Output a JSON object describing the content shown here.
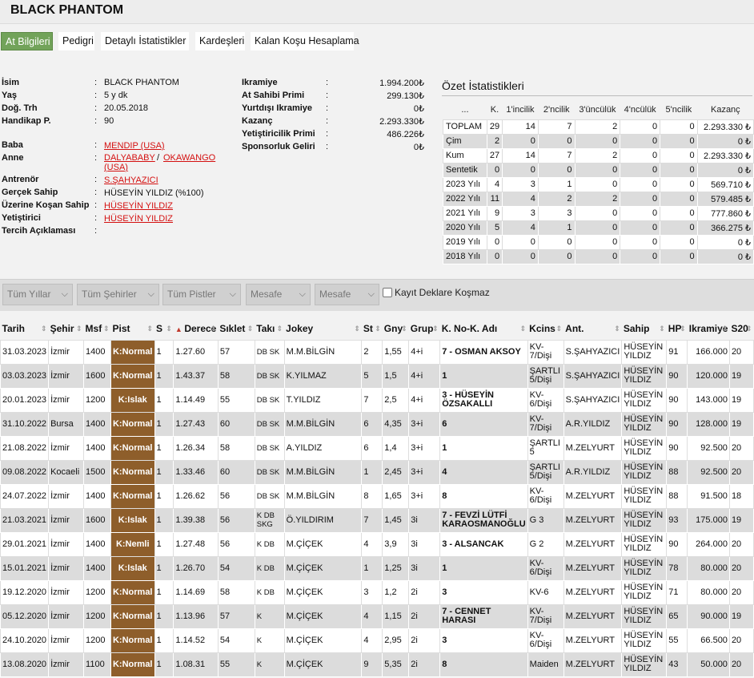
{
  "horse_name": "BLACK PHANTOM",
  "tabs": [
    {
      "label": "At Bilgileri"
    },
    {
      "label": "Pedigri"
    },
    {
      "label": "Detaylı İstatistikler"
    },
    {
      "label": "Kardeşleri"
    },
    {
      "label": "Kalan Koşu Hesaplama"
    }
  ],
  "info": {
    "isim_label": "İsim",
    "isim": "BLACK PHANTOM",
    "yas_label": "Yaş",
    "yas": "5 y dk",
    "dogum_label": "Doğ. Trh",
    "dogum": "20.05.2018",
    "handikap_label": "Handikap P.",
    "handikap": "90",
    "baba_label": "Baba",
    "baba": "MENDIP (USA)",
    "anne_label": "Anne",
    "anne_a": "DALYABABY",
    "anne_sep": "/",
    "anne_b1": "OKAWANGO",
    "anne_b2": "(USA)",
    "antrenor_label": "Antrenör",
    "antrenor": "S.ŞAHYAZICI",
    "gercek_sahip_label": "Gerçek Sahip",
    "gercek_sahip": "HÜSEYİN YILDIZ (%100)",
    "uzerine_label": "Üzerine Koşan Sahip",
    "uzerine": "HÜSEYİN YILDIZ",
    "yetistirici_label": "Yetiştirici",
    "yetistirici": "HÜSEYİN YILDIZ",
    "tercih_label": "Tercih Açıklaması",
    "colon": ":"
  },
  "money": {
    "ikramiye_label": "Ikramiye",
    "ikramiye": "1.994.200₺",
    "sahip_primi_label": "At Sahibi Primi",
    "sahip_primi": "299.130₺",
    "yurtdisi_label": "Yurtdışı Ikramiye",
    "yurtdisi": "0₺",
    "kazanc_label": "Kazanç",
    "kazanc": "2.293.330₺",
    "yetistiricilik_label": "Yetiştiricilik Primi",
    "yetistiricilik": "486.226₺",
    "sponsorluk_label": "Sponsorluk Geliri",
    "sponsorluk": "0₺"
  },
  "stats": {
    "title": "Özet İstatistikleri",
    "headers": [
      "...",
      "K.",
      "1'incilik",
      "2'ncilik",
      "3'üncülük",
      "4'ncülük",
      "5'ncilik",
      "Kazanç"
    ],
    "rows": [
      [
        "TOPLAM",
        "29",
        "14",
        "7",
        "2",
        "0",
        "0",
        "2.293.330 ₺"
      ],
      [
        "Çim",
        "2",
        "0",
        "0",
        "0",
        "0",
        "0",
        "0 ₺"
      ],
      [
        "Kum",
        "27",
        "14",
        "7",
        "2",
        "0",
        "0",
        "2.293.330 ₺"
      ],
      [
        "Sentetik",
        "0",
        "0",
        "0",
        "0",
        "0",
        "0",
        "0 ₺"
      ],
      [
        "2023 Yılı",
        "4",
        "3",
        "1",
        "0",
        "0",
        "0",
        "569.710 ₺"
      ],
      [
        "2022 Yılı",
        "11",
        "4",
        "2",
        "2",
        "0",
        "0",
        "579.485 ₺"
      ],
      [
        "2021 Yılı",
        "9",
        "3",
        "3",
        "0",
        "0",
        "0",
        "777.860 ₺"
      ],
      [
        "2020 Yılı",
        "5",
        "4",
        "1",
        "0",
        "0",
        "0",
        "366.275 ₺"
      ],
      [
        "2019 Yılı",
        "0",
        "0",
        "0",
        "0",
        "0",
        "0",
        "0 ₺"
      ],
      [
        "2018 Yılı",
        "0",
        "0",
        "0",
        "0",
        "0",
        "0",
        "0 ₺"
      ]
    ]
  },
  "filters": {
    "yillar": "Tüm Yıllar",
    "sehirler": "Tüm Şehirler",
    "pistler": "Tüm Pistler",
    "mesafe1": "Mesafe",
    "mesafe2": "Mesafe",
    "kayit": "Kayıt Deklare Koşmaz"
  },
  "races": {
    "headers": [
      "Tarih",
      "Şehir",
      "Msf",
      "Pist",
      "S",
      "Derece",
      "Sıklet",
      "Takı",
      "Jokey",
      "St",
      "Gny",
      "Grup",
      "K. No-K. Adı",
      "Kcins",
      "Ant.",
      "Sahip",
      "HP",
      "Ikramiye",
      "S20"
    ],
    "rows": [
      [
        "31.03.2023",
        "İzmir",
        "1400",
        "K:Normal",
        "1",
        "1.27.60",
        "57",
        "DB SK",
        "M.M.BİLGİN",
        "2",
        "1,55",
        "4+i",
        "7 - OSMAN AKSOY",
        "KV-7/Dişi",
        "S.ŞAHYAZICI",
        "HÜSEYİN YILDIZ",
        "91",
        "166.000",
        "20"
      ],
      [
        "03.03.2023",
        "İzmir",
        "1600",
        "K:Normal",
        "1",
        "1.43.37",
        "58",
        "DB SK",
        "K.YILMAZ",
        "5",
        "1,5",
        "4+i",
        "1",
        "ŞARTLI 5/Dişi",
        "S.ŞAHYAZICI",
        "HÜSEYİN YILDIZ",
        "90",
        "120.000",
        "19"
      ],
      [
        "20.01.2023",
        "İzmir",
        "1200",
        "K:Islak",
        "1",
        "1.14.49",
        "55",
        "DB SK",
        "T.YILDIZ",
        "7",
        "2,5",
        "4+i",
        "3 - HÜSEYİN ÖZSAKALLI",
        "KV-6/Dişi",
        "S.ŞAHYAZICI",
        "HÜSEYİN YILDIZ",
        "90",
        "143.000",
        "19"
      ],
      [
        "31.10.2022",
        "Bursa",
        "1400",
        "K:Normal",
        "1",
        "1.27.43",
        "60",
        "DB SK",
        "M.M.BİLGİN",
        "6",
        "4,35",
        "3+i",
        "6",
        "KV-7/Dişi",
        "A.R.YILDIZ",
        "HÜSEYİN YILDIZ",
        "90",
        "128.000",
        "19"
      ],
      [
        "21.08.2022",
        "İzmir",
        "1400",
        "K:Normal",
        "1",
        "1.26.34",
        "58",
        "DB SK",
        "A.YILDIZ",
        "6",
        "1,4",
        "3+i",
        "1",
        "ŞARTLI 5",
        "M.ZELYURT",
        "HÜSEYİN YILDIZ",
        "90",
        "92.500",
        "20"
      ],
      [
        "09.08.2022",
        "Kocaeli",
        "1500",
        "K:Normal",
        "1",
        "1.33.46",
        "60",
        "DB SK",
        "M.M.BİLGİN",
        "1",
        "2,45",
        "3+i",
        "4",
        "ŞARTLI 5/Dişi",
        "A.R.YILDIZ",
        "HÜSEYİN YILDIZ",
        "88",
        "92.500",
        "20"
      ],
      [
        "24.07.2022",
        "İzmir",
        "1400",
        "K:Normal",
        "1",
        "1.26.62",
        "56",
        "DB SK",
        "M.M.BİLGİN",
        "8",
        "1,65",
        "3+i",
        "8",
        "KV-6/Dişi",
        "M.ZELYURT",
        "HÜSEYİN YILDIZ",
        "88",
        "91.500",
        "18"
      ],
      [
        "21.03.2021",
        "İzmir",
        "1600",
        "K:Islak",
        "1",
        "1.39.38",
        "56",
        "K DB SKG",
        "Ö.YILDIRIM",
        "7",
        "1,45",
        "3i",
        "7 - FEVZİ LÜTFİ KARAOSMANOĞLU",
        "G 3",
        "M.ZELYURT",
        "HÜSEYİN YILDIZ",
        "93",
        "175.000",
        "19"
      ],
      [
        "29.01.2021",
        "İzmir",
        "1400",
        "K:Nemli",
        "1",
        "1.27.48",
        "56",
        "K DB",
        "M.ÇİÇEK",
        "4",
        "3,9",
        "3i",
        "3 - ALSANCAK",
        "G 2",
        "M.ZELYURT",
        "HÜSEYİN YILDIZ",
        "90",
        "264.000",
        "20"
      ],
      [
        "15.01.2021",
        "İzmir",
        "1400",
        "K:Islak",
        "1",
        "1.26.70",
        "54",
        "K DB",
        "M.ÇİÇEK",
        "1",
        "1,25",
        "3i",
        "1",
        "KV-6/Dişi",
        "M.ZELYURT",
        "HÜSEYİN YILDIZ",
        "78",
        "80.000",
        "20"
      ],
      [
        "19.12.2020",
        "İzmir",
        "1200",
        "K:Normal",
        "1",
        "1.14.69",
        "58",
        "K DB",
        "M.ÇİÇEK",
        "3",
        "1,2",
        "2i",
        "3",
        "KV-6",
        "M.ZELYURT",
        "HÜSEYİN YILDIZ",
        "71",
        "80.000",
        "20"
      ],
      [
        "05.12.2020",
        "İzmir",
        "1200",
        "K:Normal",
        "1",
        "1.13.96",
        "57",
        "K",
        "M.ÇİÇEK",
        "4",
        "1,15",
        "2i",
        "7 - CENNET HARASI",
        "KV-7/Dişi",
        "M.ZELYURT",
        "HÜSEYİN YILDIZ",
        "65",
        "90.000",
        "19"
      ],
      [
        "24.10.2020",
        "İzmir",
        "1200",
        "K:Normal",
        "1",
        "1.14.52",
        "54",
        "K",
        "M.ÇİÇEK",
        "4",
        "2,95",
        "2i",
        "3",
        "KV-6/Dişi",
        "M.ZELYURT",
        "HÜSEYİN YILDIZ",
        "55",
        "66.500",
        "20"
      ],
      [
        "13.08.2020",
        "İzmir",
        "1100",
        "K:Normal",
        "1",
        "1.08.31",
        "55",
        "K",
        "M.ÇİÇEK",
        "9",
        "5,35",
        "2i",
        "8",
        "Maiden",
        "M.ZELYURT",
        "HÜSEYİN YILDIZ",
        "43",
        "50.000",
        "20"
      ]
    ]
  },
  "colors": {
    "tab_active": "#72a35a",
    "pist_brown": "#8e5e2b",
    "link_red": "#d41010"
  }
}
